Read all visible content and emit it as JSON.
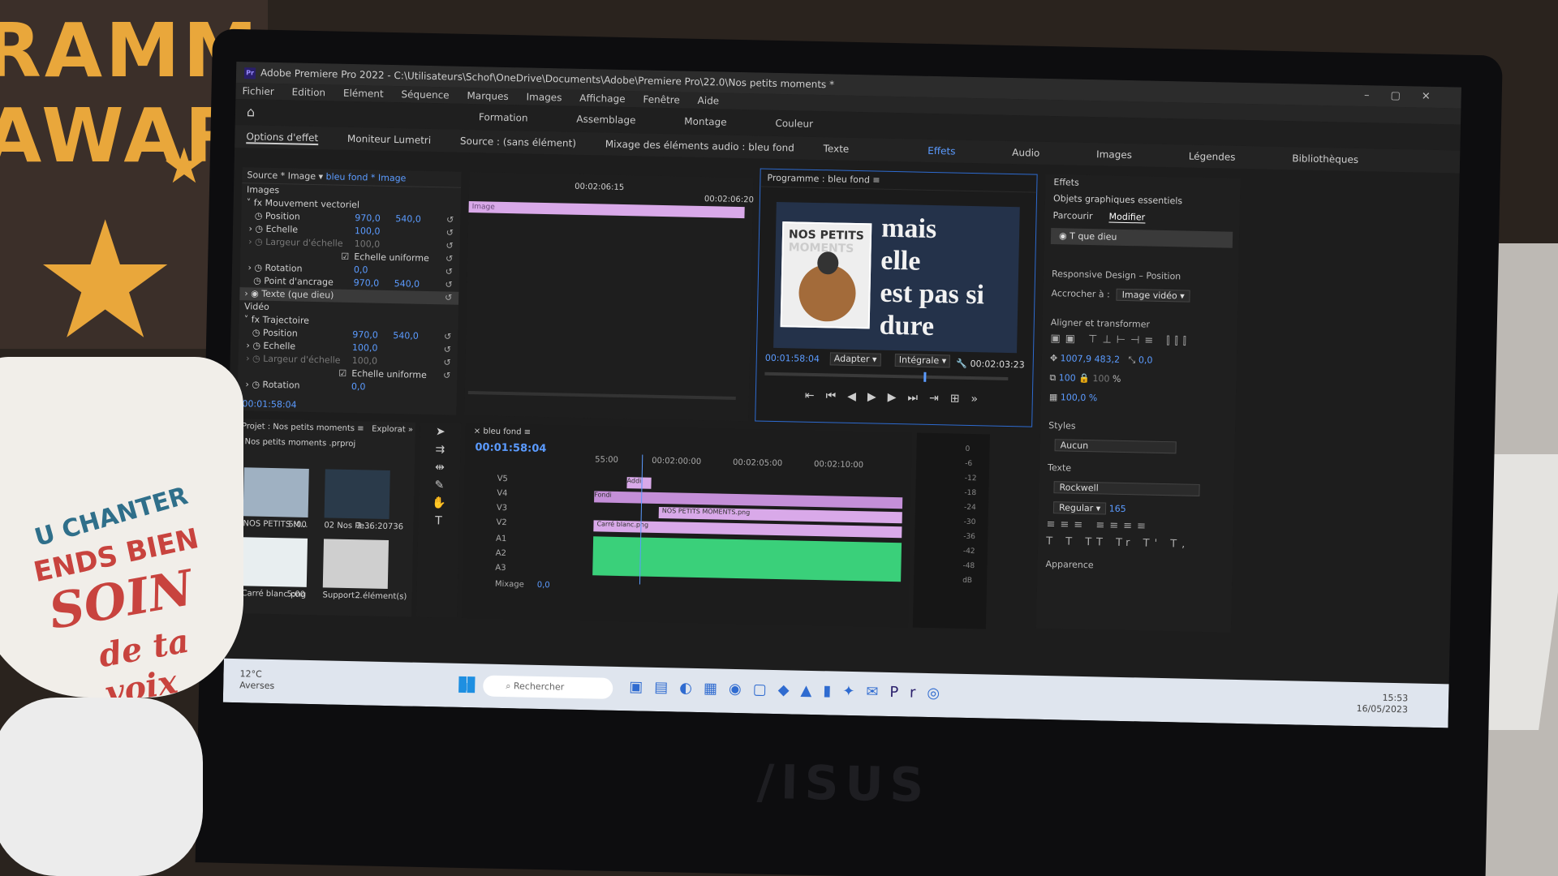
{
  "window": {
    "title": "Adobe Premiere Pro 2022 - C:\\Utilisateurs\\Schof\\OneDrive\\Documents\\Adobe\\Premiere Pro\\22.0\\Nos petits moments *"
  },
  "menu": [
    "Fichier",
    "Edition",
    "Elément",
    "Séquence",
    "Marques",
    "Images",
    "Affichage",
    "Fenêtre",
    "Aide"
  ],
  "workspaces": {
    "row1": [
      "Formation",
      "Assemblage",
      "Montage",
      "Couleur"
    ],
    "row2": [
      "Effets",
      "Audio",
      "Images",
      "Légendes",
      "Bibliothèques"
    ],
    "active": "Effets"
  },
  "panel_tabs": [
    "Options d'effet",
    "Moniteur Lumetri",
    "Source : (sans élément)",
    "Mixage des éléments audio : bleu fond",
    "Texte"
  ],
  "effect_controls": {
    "source": "Source * Image",
    "clip": "bleu fond * Image",
    "time1": "00:02:06:15",
    "time2": "00:02:06:20",
    "clip_label": "Image",
    "sec_images": "Images",
    "motion": "Mouvement vectoriel",
    "rows": [
      {
        "label": "Position",
        "v1": "970,0",
        "v2": "540,0"
      },
      {
        "label": "Echelle",
        "v1": "100,0",
        "v2": ""
      },
      {
        "label": "Largeur d'échelle",
        "v1": "100,0",
        "v2": ""
      },
      {
        "label": "Echelle uniforme",
        "v1": "",
        "v2": ""
      },
      {
        "label": "Rotation",
        "v1": "0,0",
        "v2": ""
      },
      {
        "label": "Point d'ancrage",
        "v1": "970,0",
        "v2": "540,0"
      }
    ],
    "text_layer": "Texte (que dieu)",
    "sec_video": "Vidéo",
    "trajectoire": "Trajectoire",
    "rows2": [
      {
        "label": "Position",
        "v1": "970,0",
        "v2": "540,0"
      },
      {
        "label": "Echelle",
        "v1": "100,0",
        "v2": ""
      },
      {
        "label": "Largeur d'échelle",
        "v1": "100,0",
        "v2": ""
      },
      {
        "label": "Echelle uniforme",
        "v1": "",
        "v2": ""
      },
      {
        "label": "Rotation",
        "v1": "0,0",
        "v2": ""
      }
    ],
    "timecode": "00:01:58:04"
  },
  "program": {
    "title": "Programme : bleu fond",
    "album_line1": "NOS PETITS",
    "album_line2": "MOMENTS",
    "lyrics": [
      "mais",
      "elle",
      "est pas si",
      "dure"
    ],
    "timecode": "00:01:58:04",
    "fit": "Adapter",
    "quality": "Intégrale",
    "duration": "00:02:03:23"
  },
  "right_panel": {
    "effects": "Effets",
    "essential": "Objets graphiques essentiels",
    "tab_browse": "Parcourir",
    "tab_edit": "Modifier",
    "layer": "que dieu",
    "responsive": "Responsive Design – Position",
    "attach_label": "Accrocher à :",
    "attach_value": "Image vidéo",
    "align": "Aligner et transformer",
    "pos_x": "1007,9",
    "pos_y": "483,2",
    "rot": "0,0",
    "scale": "100",
    "scale2": "100",
    "opacity": "100,0 %",
    "styles": "Styles",
    "style_value": "Aucun",
    "text": "Texte",
    "font": "Rockwell",
    "weight": "Regular",
    "size": "165",
    "appearance": "Apparence"
  },
  "project": {
    "title": "Projet : Nos petits moments",
    "explorer": "Explorat",
    "file": "Nos petits moments .prproj",
    "items": [
      {
        "name": "NOS PETITS M...",
        "dur": "5:00"
      },
      {
        "name": "02 Nos Pe...",
        "dur": "2:36:20736"
      },
      {
        "name": "Carré blanc.png",
        "dur": "5:00"
      },
      {
        "name": "Support...",
        "dur": "2 élément(s)"
      }
    ]
  },
  "timeline": {
    "seq": "bleu fond",
    "timecode": "00:01:58:04",
    "ruler": [
      "55:00",
      "00:02:00:00",
      "00:02:05:00",
      "00:02:10:00"
    ],
    "tracks": [
      "V5",
      "V4",
      "V3",
      "V2",
      "A1",
      "A2",
      "A3"
    ],
    "mix_label": "Mixage",
    "mix_value": "0,0",
    "clip_names": [
      "Addi",
      "Fondi",
      "Fondi",
      "NOS PETITS MOMENTS.png",
      "Carré blanc.png"
    ]
  },
  "meters": [
    "0",
    "-6",
    "-12",
    "-18",
    "-24",
    "-30",
    "-36",
    "-42",
    "-48",
    "dB"
  ],
  "taskbar": {
    "temp": "12°C",
    "weather": "Averses",
    "search": "Rechercher",
    "time": "15:53",
    "date": "16/05/2023"
  },
  "decor": {
    "poster": [
      "RAMM",
      "AWARI"
    ],
    "mug": [
      "U CHANTER",
      "ENDS BIEN",
      "SOIN",
      "de ta voix"
    ],
    "brand": "/ISUS"
  },
  "colors": {
    "accent": "#5b9bff",
    "clip_pink": "#d9a9e9",
    "audio_green": "#3ad07a"
  }
}
